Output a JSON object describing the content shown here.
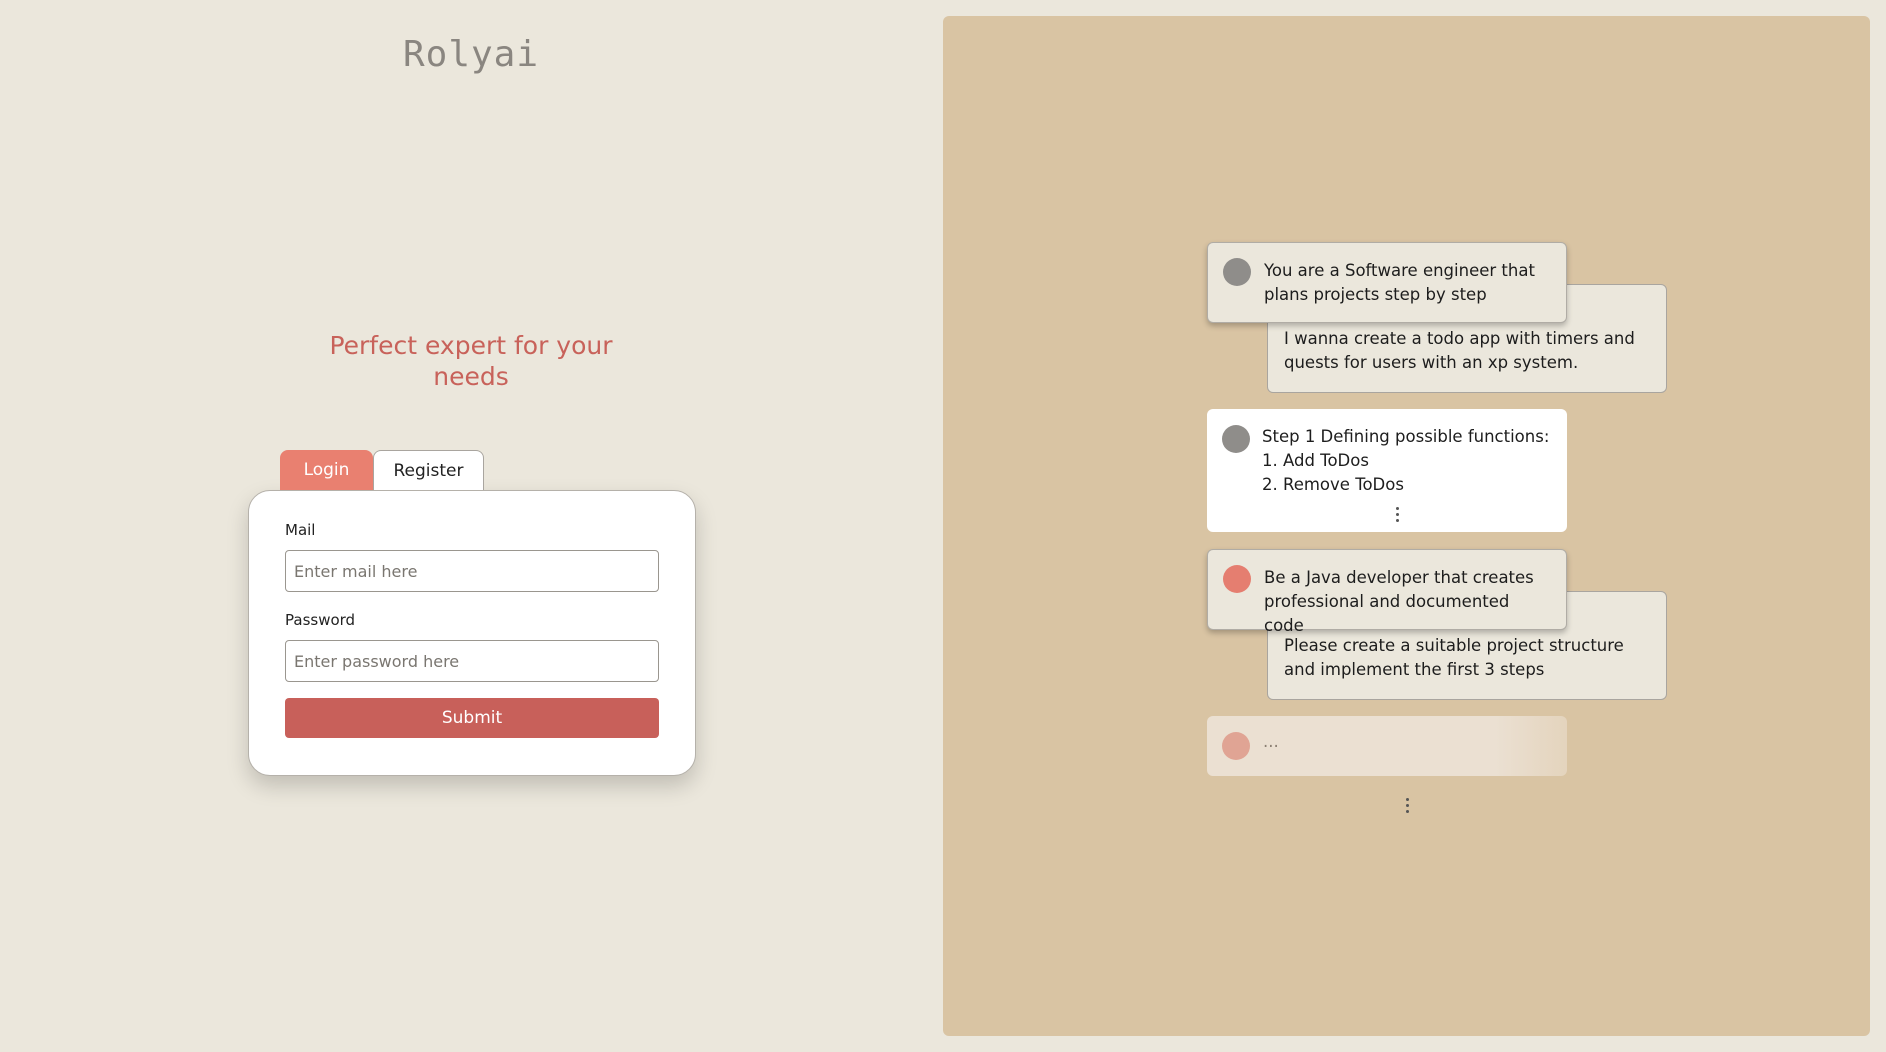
{
  "brand": {
    "name": "Rolyai"
  },
  "hero": {
    "tagline": "Perfect expert for your needs"
  },
  "auth": {
    "tabs": {
      "login": "Login",
      "register": "Register"
    },
    "active_tab": "Login",
    "mail": {
      "label": "Mail",
      "placeholder": "Enter mail here",
      "value": ""
    },
    "password": {
      "label": "Password",
      "placeholder": "Enter password here",
      "value": ""
    },
    "submit_label": "Submit"
  },
  "preview": {
    "conversation": [
      {
        "system": "You are a Software engineer that plans projects step by step",
        "user": "I wanna create a todo app with timers and quests for users with an xp system."
      },
      {
        "response_lines": [
          "Step 1 Defining possible functions:",
          "1. Add ToDos",
          "2. Remove ToDos"
        ]
      },
      {
        "system": "Be a Java developer that creates professional and documented code",
        "user": "Please create a suitable project structure and implement the first 3 steps"
      },
      {
        "pending": "..."
      }
    ]
  },
  "colors": {
    "background": "#ebe7dc",
    "preview_panel": "#d9c4a3",
    "accent": "#e98070",
    "submit": "#c8605a",
    "tagline": "#c8625a"
  }
}
